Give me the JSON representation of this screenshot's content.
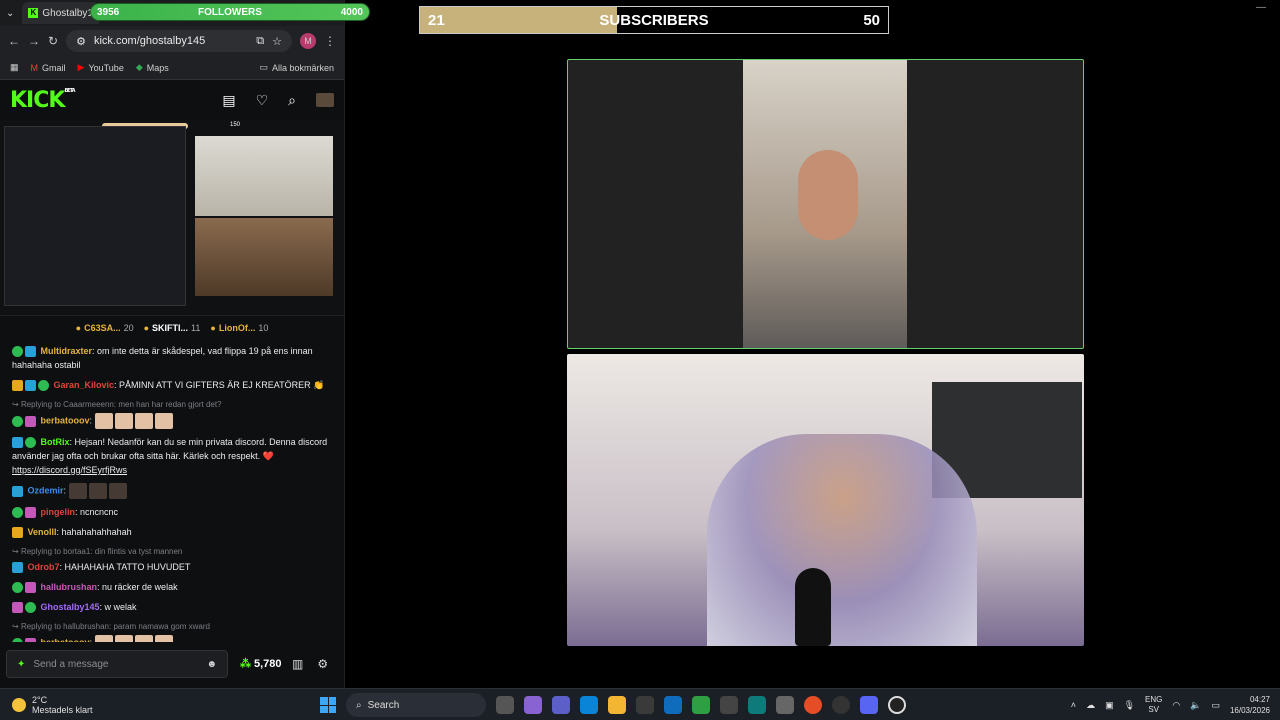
{
  "overlays": {
    "followers": {
      "label": "FOLLOWERS",
      "current": "3956",
      "goal": "4000"
    },
    "subscribers": {
      "label": "SUBSCRIBERS",
      "current": "21",
      "goal": "50",
      "progress": 0.42
    }
  },
  "browser": {
    "tab_title": "Ghostalby1",
    "url": "kick.com/ghostalby145",
    "profile_letter": "M",
    "bookmarks": [
      "Gmail",
      "YouTube",
      "Maps"
    ],
    "bookmarks_all": "Alla bokmärken"
  },
  "kick": {
    "logo": "KICK",
    "logo_tag": "BETA",
    "stream_overlay_number": "150"
  },
  "leaderboard": [
    {
      "name": "C63SA...",
      "count": "20"
    },
    {
      "name": "SKIFTI...",
      "count": "11"
    },
    {
      "name": "LionOf...",
      "count": "10"
    }
  ],
  "chat": {
    "messages": [
      {
        "user": "Multidraxter",
        "color": "#e6b43c",
        "text": ": om inte detta är skådespel, vad flippa 19 på ens innan hahahaha ostabil"
      },
      {
        "user": "Garan_Kilovic",
        "color": "#e0443a",
        "text": ": PÅMINN ATT VI GIFTERS ÄR EJ KREATÖRER 👏"
      },
      {
        "reply": "Replying to Caaarmeeenn: men han har redan gjort det?",
        "user": "berbatooov",
        "color": "#e6b43c",
        "text": ":"
      },
      {
        "user": "BotRix",
        "color": "#53fc18",
        "text": ": Hejsan! Nedanför kan du se min privata discord. Denna discord använder jag ofta och brukar ofta sitta här. Kärlek och respekt. ❤️",
        "link": "https://discord.gg/fSEyrfjRws"
      },
      {
        "user": "Ozdemir",
        "color": "#3b8ef0",
        "text": ":"
      },
      {
        "user": "pingelin",
        "color": "#e0443a",
        "text": ": ncncncnc"
      },
      {
        "user": "Venolll",
        "color": "#e6b43c",
        "text": ": hahahahahhahah"
      },
      {
        "reply": "Replying to bortaa1: din flintis va tyst mannen",
        "user": "Odrob7",
        "color": "#e0443a",
        "text": ": HAHAHAHA TATTO HUVUDET"
      },
      {
        "user": "hallubrushan",
        "color": "#c557b9",
        "text": ": nu räcker de welak"
      },
      {
        "user": "Ghostalby145",
        "color": "#a36cf5",
        "text": ": w welak"
      },
      {
        "reply": "Replying to hallubrushan: param namawa gom xward",
        "user": "berbatooov",
        "color": "#e6b43c",
        "text": ":"
      }
    ],
    "input_placeholder": "Send a message",
    "points": "5,780"
  },
  "taskbar": {
    "temp": "2°C",
    "weather": "Mestadels klart",
    "search": "Search",
    "lang1": "ENG",
    "lang2": "SV",
    "time": "04:27",
    "date": "16/03/2026"
  }
}
